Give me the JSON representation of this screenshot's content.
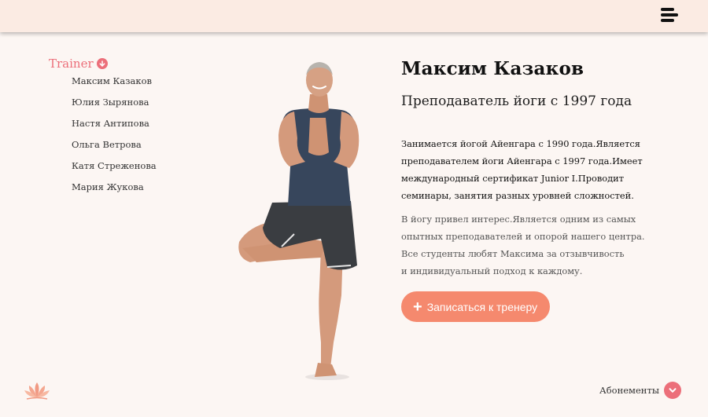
{
  "sidebar": {
    "heading": "Trainer",
    "trainers": [
      "Максим Казаков",
      "Юлия Зырянова",
      "Настя Антипова",
      "Ольга Ветрова",
      "Катя Стреженова",
      "Мария Жукова"
    ]
  },
  "profile": {
    "name": "Максим Казаков",
    "role": "Преподаватель йоги с 1997 года",
    "bio_lines": [
      "Занимается йогой Айенгара с 1990 года.Является",
      "преподавателем йоги Айенгара с 1997 года.Имеет",
      "международный сертификат Junior I.Проводит",
      "семинары, занятия разных уровней сложностей."
    ],
    "about_lines": [
      "В йогу привел интерес.Является одним из самых",
      "опытных преподавателей и опорой нашего центра.",
      "Все студенты любят Максима за отзывчивость",
      "и индивидуальный подход к каждому."
    ],
    "cta_plus": "+",
    "cta_label": "Записаться к тренеру"
  },
  "footer": {
    "subscriptions_label": "Абонементы"
  },
  "icons": {
    "menu": "hamburger-menu-icon",
    "dropdown": "chevron-down-icon",
    "logo": "lotus-icon"
  },
  "colors": {
    "header_bg": "#fbebe3",
    "page_bg": "#fcf6f3",
    "accent_pink": "#ec6f7a",
    "button_coral": "#f5896e"
  }
}
